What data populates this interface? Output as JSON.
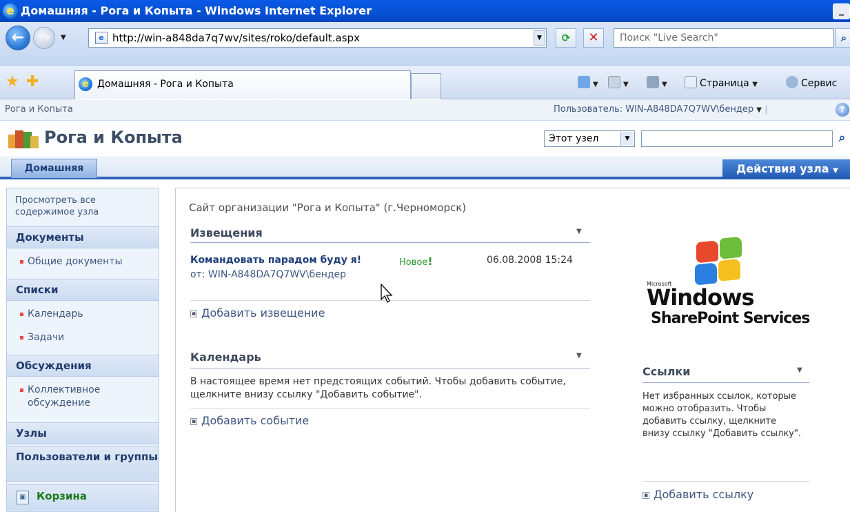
{
  "browser": {
    "window_title": "Домашняя - Рога и Копыта - Windows Internet Explorer",
    "address": "http://win-a848da7q7wv/sites/roko/default.aspx",
    "search_placeholder": "Поиск \"Live Search\"",
    "tab_label": "Домашняя - Рога и Копыта",
    "cmd_page": "Страница",
    "cmd_service": "Сервис",
    "min_label": "_"
  },
  "sharepoint": {
    "breadcrumb": "Рога и Копыта",
    "user": "Пользователь: WIN-A848DA7Q7WV\\бендер",
    "site_title": "Рога и Копыта",
    "scope_value": "Этот узел",
    "tab_home": "Домашняя",
    "site_actions": "Действия узла"
  },
  "leftnav": {
    "view_all": "Просмотреть все содержимое узла",
    "sections": [
      {
        "title": "Документы",
        "items": [
          "Общие документы"
        ]
      },
      {
        "title": "Списки",
        "items": [
          "Календарь",
          "Задачи"
        ]
      },
      {
        "title": "Обсуждения",
        "items": [
          "Коллективное обсуждение"
        ]
      },
      {
        "title": "Узлы",
        "items": []
      },
      {
        "title": "Пользователи и группы",
        "items": []
      }
    ],
    "recycle_bin": "Корзина"
  },
  "main": {
    "site_description": "Сайт организации \"Рога и Копыта\" (г.Черноморск)",
    "announcements": {
      "title": "Извещения",
      "item_title": "Командовать парадом буду я!",
      "item_new": "Новое",
      "item_date": "06.08.2008 15:24",
      "item_author": "от: WIN-A848DA7Q7WV\\бендер",
      "add_link": "Добавить извещение"
    },
    "calendar": {
      "title": "Календарь",
      "empty_text": "В настоящее время нет предстоящих событий. Чтобы добавить событие, щелкните внизу ссылку \"Добавить событие\".",
      "add_link": "Добавить событие"
    }
  },
  "right": {
    "logo_microsoft": "Microsoft",
    "logo_windows": "Windows",
    "logo_sps": "SharePoint Services",
    "links": {
      "title": "Ссылки",
      "empty_text": "Нет избранных ссылок, которые можно отобразить. Чтобы добавить ссылку, щелкните внизу ссылку \"Добавить ссылку\".",
      "add_link": "Добавить ссылку"
    }
  },
  "colors": {
    "ie_titlebar": "#0653d6",
    "sp_nav_accent": "#2a63b8",
    "link_text": "#3e5680",
    "new_badge": "#2f9a2f"
  }
}
